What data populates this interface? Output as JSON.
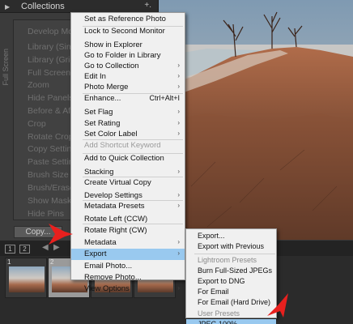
{
  "left_panel": {
    "header_title": "Collections",
    "header_plus": "+.",
    "side_label": "Full Screen",
    "ghost_items": [
      "Develop Module",
      "Library (Single)",
      "Library (Grid)",
      "Full Screen",
      "Zoom",
      "Hide Panels",
      "Before & After",
      "Crop",
      "Rotate Crop",
      "Copy Settings",
      "Paste Settings",
      "Brush Size",
      "Brush/Eraser",
      "Show Mask Overlay",
      "Hide Pins"
    ],
    "copy_button": "Copy..."
  },
  "filmstrip": {
    "page_boxes": [
      "1",
      "2"
    ],
    "thumb_numbers": [
      "1",
      "2"
    ]
  },
  "context_menu": {
    "items": [
      {
        "label": "Set as Reference Photo",
        "shortcut": "",
        "submenu": false,
        "disabled": false,
        "highlighted": false
      },
      {
        "label": "Lock to Second Monitor",
        "shortcut": "",
        "submenu": false,
        "disabled": false,
        "highlighted": false
      },
      {
        "label": "Show in Explorer",
        "shortcut": "",
        "submenu": false,
        "disabled": false,
        "highlighted": false
      },
      {
        "label": "Go to Folder in Library",
        "shortcut": "",
        "submenu": false,
        "disabled": false,
        "highlighted": false
      },
      {
        "label": "Go to Collection",
        "shortcut": "",
        "submenu": true,
        "disabled": false,
        "highlighted": false
      },
      {
        "label": "Edit In",
        "shortcut": "",
        "submenu": true,
        "disabled": false,
        "highlighted": false
      },
      {
        "label": "Photo Merge",
        "shortcut": "",
        "submenu": true,
        "disabled": false,
        "highlighted": false
      },
      {
        "label": "Enhance...",
        "shortcut": "Ctrl+Alt+I",
        "submenu": false,
        "disabled": false,
        "highlighted": false
      },
      {
        "label": "Set Flag",
        "shortcut": "",
        "submenu": true,
        "disabled": false,
        "highlighted": false
      },
      {
        "label": "Set Rating",
        "shortcut": "",
        "submenu": true,
        "disabled": false,
        "highlighted": false
      },
      {
        "label": "Set Color Label",
        "shortcut": "",
        "submenu": true,
        "disabled": false,
        "highlighted": false
      },
      {
        "label": "Add Shortcut Keyword",
        "shortcut": "",
        "submenu": false,
        "disabled": true,
        "highlighted": false
      },
      {
        "label": "Add to Quick Collection",
        "shortcut": "",
        "submenu": false,
        "disabled": false,
        "highlighted": false
      },
      {
        "label": "Stacking",
        "shortcut": "",
        "submenu": true,
        "disabled": false,
        "highlighted": false
      },
      {
        "label": "Create Virtual Copy",
        "shortcut": "",
        "submenu": false,
        "disabled": false,
        "highlighted": false
      },
      {
        "label": "Develop Settings",
        "shortcut": "",
        "submenu": true,
        "disabled": false,
        "highlighted": false
      },
      {
        "label": "Metadata Presets",
        "shortcut": "",
        "submenu": true,
        "disabled": false,
        "highlighted": false
      },
      {
        "label": "Rotate Left (CCW)",
        "shortcut": "",
        "submenu": false,
        "disabled": false,
        "highlighted": false
      },
      {
        "label": "Rotate Right (CW)",
        "shortcut": "",
        "submenu": false,
        "disabled": false,
        "highlighted": false
      },
      {
        "label": "Metadata",
        "shortcut": "",
        "submenu": true,
        "disabled": false,
        "highlighted": false
      },
      {
        "label": "Export",
        "shortcut": "",
        "submenu": true,
        "disabled": false,
        "highlighted": true
      },
      {
        "label": "Email Photo...",
        "shortcut": "",
        "submenu": false,
        "disabled": false,
        "highlighted": false
      },
      {
        "label": "Remove Photo...",
        "shortcut": "",
        "submenu": false,
        "disabled": false,
        "highlighted": false
      },
      {
        "label": "View Options",
        "shortcut": "",
        "submenu": true,
        "disabled": false,
        "highlighted": false
      }
    ]
  },
  "export_submenu": {
    "items": [
      {
        "label": "Export...",
        "heading": false,
        "highlighted": false
      },
      {
        "label": "Export with Previous",
        "heading": false,
        "highlighted": false
      },
      {
        "label": "Lightroom Presets",
        "heading": true,
        "highlighted": false
      },
      {
        "label": "Burn Full-Sized JPEGs",
        "heading": false,
        "highlighted": false
      },
      {
        "label": "Export to DNG",
        "heading": false,
        "highlighted": false
      },
      {
        "label": "For Email",
        "heading": false,
        "highlighted": false
      },
      {
        "label": "For Email (Hard Drive)",
        "heading": false,
        "highlighted": false
      },
      {
        "label": "User Presets",
        "heading": true,
        "highlighted": false
      },
      {
        "label": "JPEG 100%",
        "heading": false,
        "highlighted": true
      }
    ]
  },
  "colors": {
    "highlight": "#99c9ef",
    "menu_bg": "#f0f0f0",
    "annotation_arrow": "#e8201e"
  }
}
